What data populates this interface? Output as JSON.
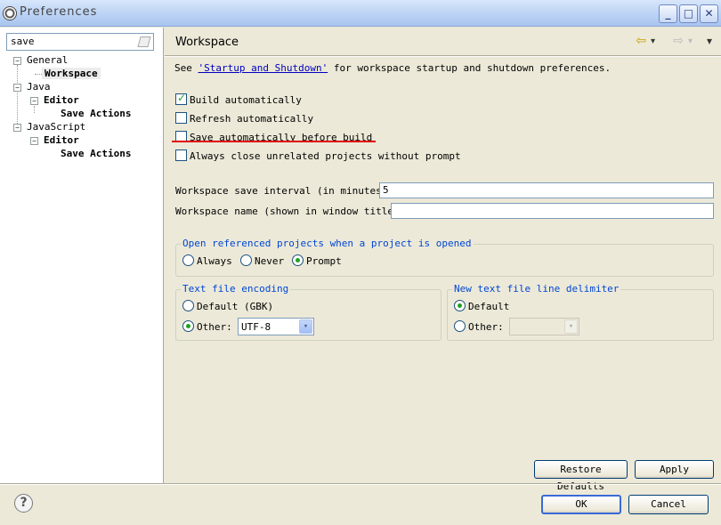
{
  "window": {
    "title": "Preferences",
    "minimize": "_",
    "maximize": "□",
    "close": "✕"
  },
  "filter": {
    "value": "save"
  },
  "tree": {
    "general": "General",
    "workspace": "Workspace",
    "java": "Java",
    "java_editor": "Editor",
    "java_save_actions": "Save Actions",
    "javascript": "JavaScript",
    "js_editor": "Editor",
    "js_save_actions": "Save Actions",
    "toggle": "−"
  },
  "page": {
    "title": "Workspace",
    "intro_prefix": "See ",
    "intro_link": "'Startup and Shutdown'",
    "intro_suffix": " for workspace startup and shutdown preferences.",
    "nav_back": "⇦",
    "nav_forward": "⇨",
    "nav_menu": "▾"
  },
  "options": {
    "build_auto": {
      "label": "Build automatically",
      "checked": true
    },
    "refresh_auto": {
      "label": "Refresh automatically",
      "checked": false
    },
    "save_before_build": {
      "label": "Save automatically before build",
      "checked": false
    },
    "close_unrelated": {
      "label": "Always close unrelated projects without prompt",
      "checked": false
    }
  },
  "save_interval": {
    "label": "Workspace save interval (in minutes):",
    "value": "5"
  },
  "workspace_name": {
    "label": "Workspace name (shown in window title):",
    "value": ""
  },
  "open_referenced": {
    "legend": "Open referenced projects when a project is opened",
    "always": "Always",
    "never": "Never",
    "prompt": "Prompt",
    "selected": "prompt"
  },
  "encoding": {
    "legend": "Text file encoding",
    "default": "Default (GBK)",
    "other": "Other:",
    "other_value": "UTF-8",
    "selected": "other"
  },
  "line_delimiter": {
    "legend": "New text file line delimiter",
    "default": "Default",
    "other": "Other:",
    "other_value": "",
    "selected": "default"
  },
  "buttons": {
    "restore": "Restore Defaults",
    "apply": "Apply",
    "ok": "OK",
    "cancel": "Cancel",
    "help": "?"
  },
  "colors": {
    "accent_link": "#0000c0",
    "legend": "#0046d5",
    "check_green": "#21a121",
    "annotation_red": "#e00000"
  }
}
